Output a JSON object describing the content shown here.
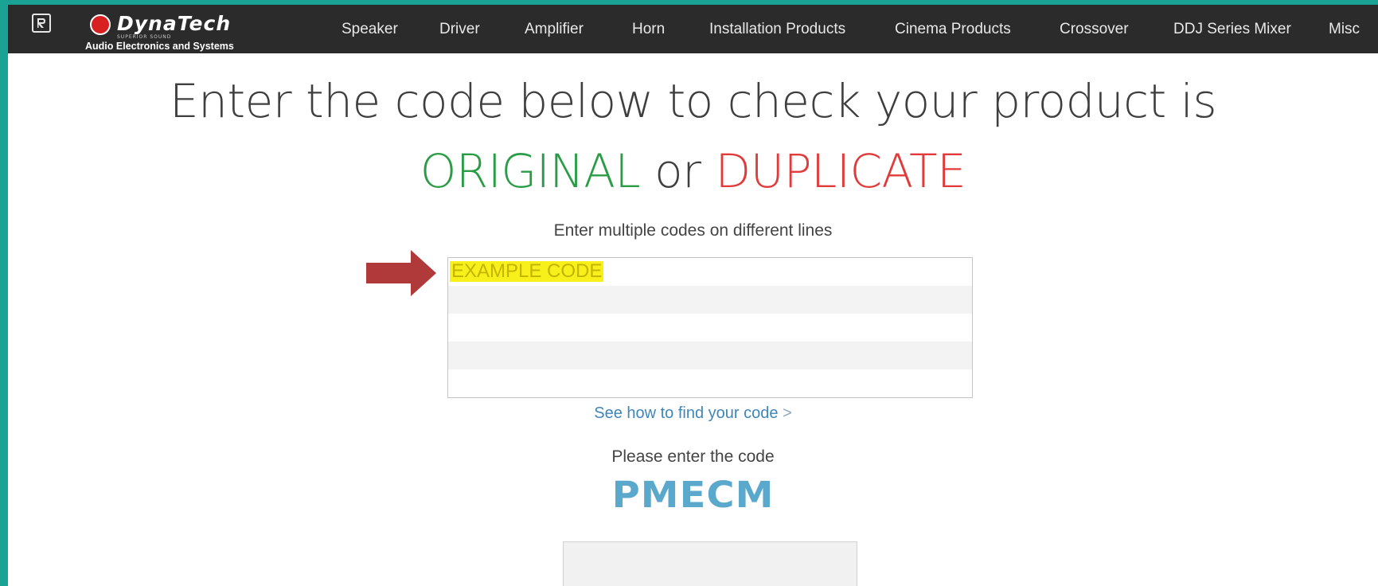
{
  "brand": {
    "tagline": "Audio Electronics and Systems",
    "logo_word": "DynaTech",
    "logo_sub": "SUPERIOR SOUND"
  },
  "nav": {
    "items": [
      "Speaker",
      "Driver",
      "Amplifier",
      "Horn",
      "Installation Products",
      "Cinema Products",
      "Crossover",
      "DDJ Series Mixer",
      "Misc"
    ]
  },
  "heading": {
    "line1": "Enter the code below to check your product is",
    "original": "ORIGINAL",
    "or": " or ",
    "duplicate": "DUPLICATE"
  },
  "form": {
    "instructions": "Enter multiple codes on different lines",
    "example_code": "EXAMPLE CODE",
    "howto_link": "See how to find your code",
    "howto_chevron": ">",
    "captcha_prompt": "Please enter the code",
    "captcha_text": "PMECM"
  },
  "colors": {
    "accent_teal": "#1aa394",
    "nav_bg": "#2b2b2b",
    "original_green": "#2a9c46",
    "duplicate_red": "#e03a3a",
    "highlight_yellow": "#f7f01a",
    "arrow_red": "#b03a3a",
    "link_blue": "#3f86b8",
    "captcha_blue": "#5aa9cc"
  },
  "icons": {
    "brand_square": "brand-logo-icon",
    "arrow": "arrow-right-icon"
  }
}
